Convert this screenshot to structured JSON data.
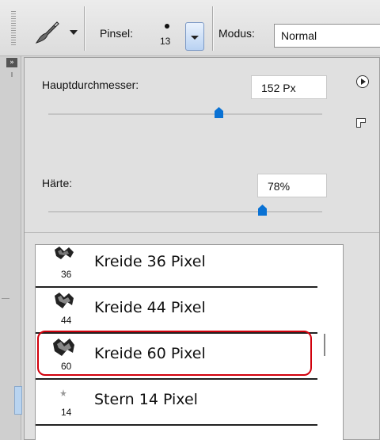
{
  "toolbar": {
    "tool_icon": "brush-tool-icon",
    "brush_label": "Pinsel:",
    "brush_size": "13",
    "mode_label": "Modus:",
    "mode_value": "Normal"
  },
  "panel": {
    "diameter_label": "Hauptdurchmesser:",
    "diameter_value": "152 Px",
    "diameter_slider": 0.62,
    "hardness_label": "Härte:",
    "hardness_value": "78%",
    "hardness_slider": 0.78
  },
  "presets": [
    {
      "name": "Kreide 36 Pixel",
      "size": "36"
    },
    {
      "name": "Kreide 44 Pixel",
      "size": "44"
    },
    {
      "name": "Kreide 60 Pixel",
      "size": "60",
      "selected": true
    },
    {
      "name": "Stern 14 Pixel",
      "size": "14"
    }
  ],
  "colors": {
    "accent": "#0a72d4",
    "highlight": "#d1000c"
  }
}
